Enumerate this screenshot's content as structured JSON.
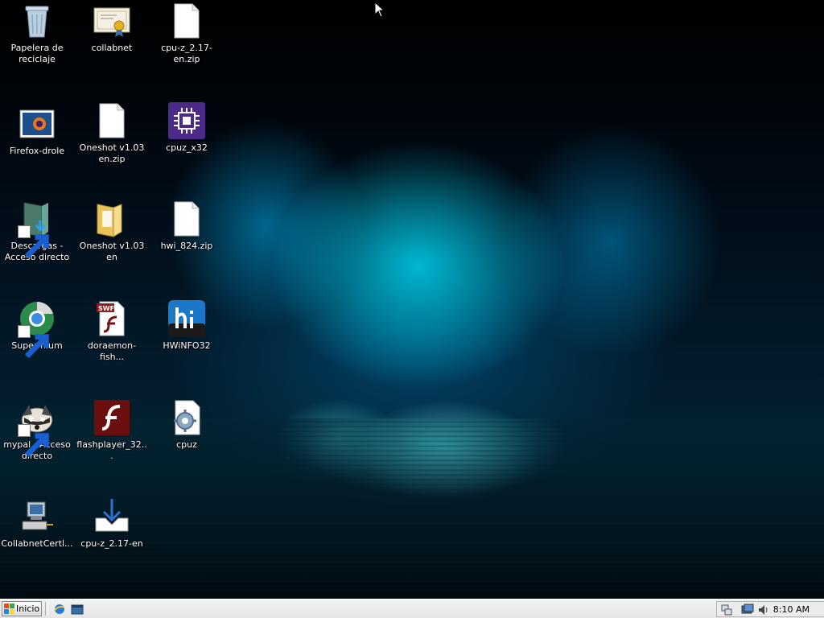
{
  "desktop": {
    "icons": [
      {
        "label": "Papelera de reciclaje",
        "icon": "recycle-bin-icon"
      },
      {
        "label": "collabnet",
        "icon": "certificate-icon"
      },
      {
        "label": "cpu-z_2.17-en.zip",
        "icon": "file-icon"
      },
      {
        "label": "Firefox-drole",
        "icon": "image-file-icon"
      },
      {
        "label": "Oneshot v1.03 en.zip",
        "icon": "file-icon"
      },
      {
        "label": "cpuz_x32",
        "icon": "cpu-icon"
      },
      {
        "label": "Descargas - Acceso directo",
        "icon": "downloads-folder-icon"
      },
      {
        "label": "Oneshot v1.03 en",
        "icon": "folder-icon"
      },
      {
        "label": "hwi_824.zip",
        "icon": "file-icon"
      },
      {
        "label": "Supermium",
        "icon": "browser-icon"
      },
      {
        "label": "doraemon-fish...",
        "icon": "swf-file-icon"
      },
      {
        "label": "HWiNFO32",
        "icon": "hwinfo-icon"
      },
      {
        "label": "mypal - Acceso directo",
        "icon": "raccoon-icon"
      },
      {
        "label": "flashplayer_32...",
        "icon": "flash-icon"
      },
      {
        "label": "cpuz",
        "icon": "config-file-icon"
      },
      {
        "label": "CollabnetCertl...",
        "icon": "computer-network-icon"
      },
      {
        "label": "cpu-z_2.17-en",
        "icon": "download-tray-icon"
      }
    ]
  },
  "taskbar": {
    "start_label": "Inicio",
    "clock": "8:10 AM"
  },
  "colors": {
    "taskbar_bg": "#e6e6e6",
    "wallpaper_accent": "#00e6ff"
  }
}
